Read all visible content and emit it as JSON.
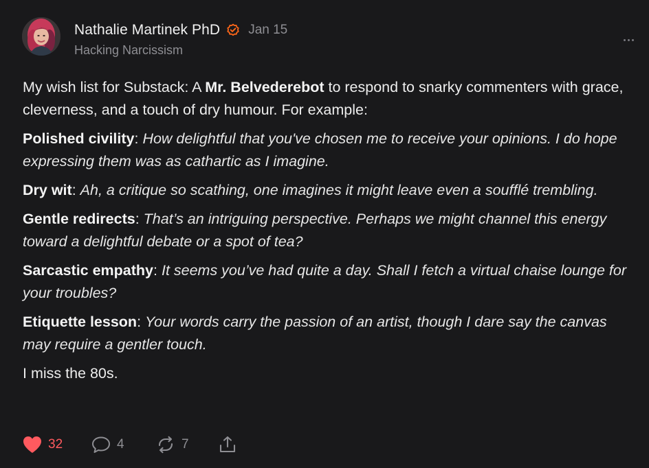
{
  "post": {
    "author": {
      "name": "Nathalie Martinek PhD",
      "verified_icon": "verified-badge-icon",
      "publication": "Hacking Narcissism"
    },
    "date": "Jan 15",
    "more_icon": "ellipsis-icon",
    "body": {
      "intro": {
        "before": "My wish list for Substack: A ",
        "bold": "Mr. Belvederebot",
        "after": " to respond to snarky commenters with grace, cleverness, and a touch of dry humour. For example:"
      },
      "items": [
        {
          "label": "Polished civility",
          "sep": ": ",
          "text": "How delightful that you've chosen me to receive your opinions. I do hope expressing them was as cathartic as I imagine."
        },
        {
          "label": "Dry wit",
          "sep": ": ",
          "text": "Ah, a critique so scathing, one imagines it might leave even a soufflé trembling."
        },
        {
          "label": "Gentle redirects",
          "sep": ": ",
          "text": "That’s an intriguing perspective. Perhaps we might channel this energy toward a delightful debate or a spot of tea?"
        },
        {
          "label": "Sarcastic empathy",
          "sep": ": ",
          "text": "It seems you’ve had quite a day. Shall I fetch a virtual chaise lounge for your troubles?"
        },
        {
          "label": "Etiquette lesson",
          "sep": ": ",
          "text": "Your words carry the passion of an artist, though I dare say the canvas may require a gentler touch."
        }
      ],
      "closing": "I miss the 80s."
    },
    "actions": {
      "likes": {
        "icon": "heart-icon",
        "count": "32",
        "liked": true
      },
      "comments": {
        "icon": "comment-icon",
        "count": "4"
      },
      "restacks": {
        "icon": "restack-icon",
        "count": "7"
      },
      "share": {
        "icon": "share-icon"
      }
    },
    "colors": {
      "background": "#19191b",
      "accent_orange": "#ff6719",
      "like_red": "#ff5a5f",
      "muted": "#8e8e93"
    }
  }
}
